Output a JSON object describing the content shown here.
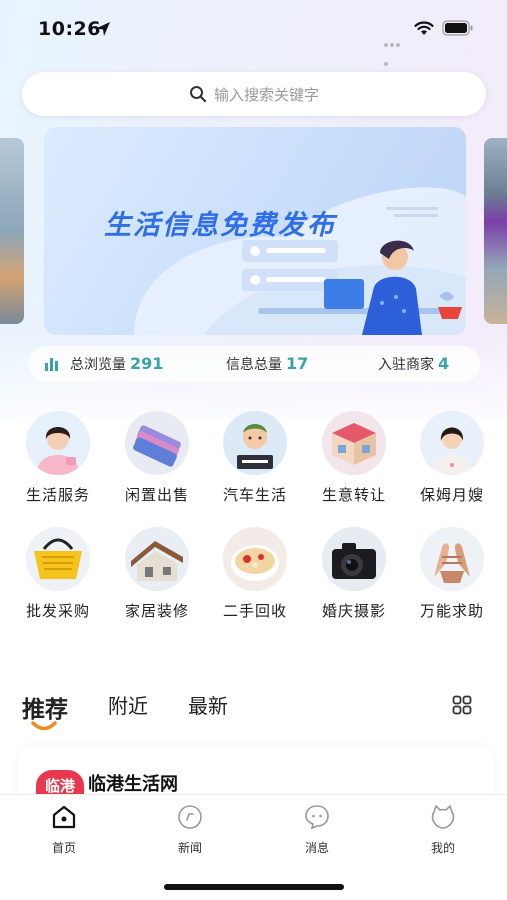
{
  "status_bar": {
    "time": "10:26"
  },
  "search": {
    "placeholder": "输入搜索关键字",
    "icon": "search-icon"
  },
  "banner": {
    "title": "生活信息免费发布"
  },
  "stats": [
    {
      "label": "总浏览量",
      "value": "291"
    },
    {
      "label": "信息总量",
      "value": "17"
    },
    {
      "label": "入驻商家",
      "value": "4"
    }
  ],
  "categories": [
    {
      "label": "生活服务",
      "icon": "housekeeper-icon"
    },
    {
      "label": "闲置出售",
      "icon": "phone-icon"
    },
    {
      "label": "汽车生活",
      "icon": "join-us-avatar-icon"
    },
    {
      "label": "生意转让",
      "icon": "shop-icon"
    },
    {
      "label": "保姆月嫂",
      "icon": "nanny-icon"
    },
    {
      "label": "批发采购",
      "icon": "basket-icon"
    },
    {
      "label": "家居装修",
      "icon": "house-icon"
    },
    {
      "label": "二手回收",
      "icon": "dessert-icon"
    },
    {
      "label": "婚庆摄影",
      "icon": "camera-icon"
    },
    {
      "label": "万能求助",
      "icon": "handshake-icon"
    }
  ],
  "tabs": {
    "recommend": "推荐",
    "nearby": "附近",
    "latest": "最新"
  },
  "card": {
    "badge": "临港",
    "title": "临港生活网"
  },
  "bottom_nav": [
    {
      "label": "首页",
      "icon": "home-icon"
    },
    {
      "label": "新闻",
      "icon": "news-icon"
    },
    {
      "label": "消息",
      "icon": "message-icon"
    },
    {
      "label": "我的",
      "icon": "profile-icon"
    }
  ],
  "colors": {
    "accent": "#2f6ee8",
    "stat_number": "#3aa3a3",
    "badge": "#e8384f",
    "tab_underline": "#f08a24"
  }
}
